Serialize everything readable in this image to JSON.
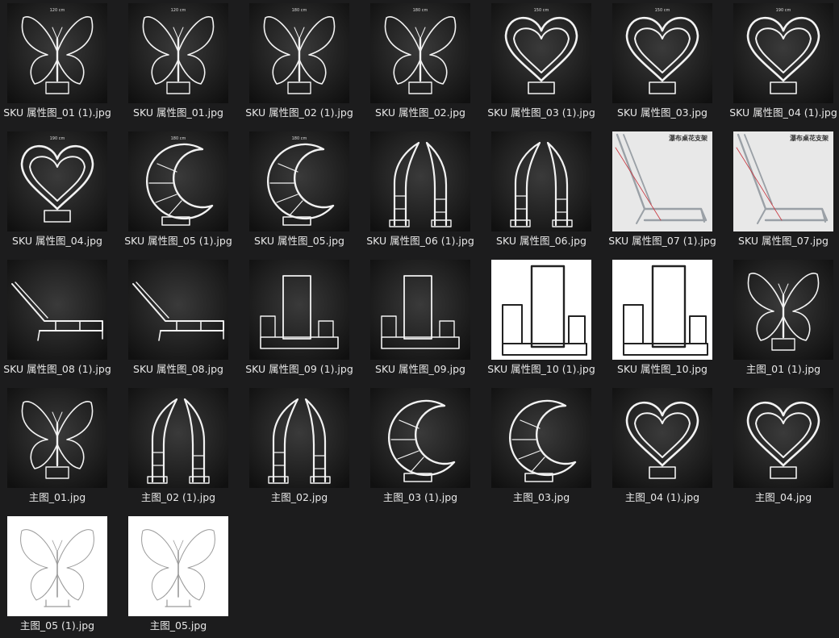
{
  "files": [
    {
      "name": "SKU 属性图_01 (1).jpg",
      "shape": "butterfly-icon",
      "bg": "dark",
      "measure": "120 cm"
    },
    {
      "name": "SKU 属性图_01.jpg",
      "shape": "butterfly-icon",
      "bg": "dark",
      "measure": "120 cm"
    },
    {
      "name": "SKU 属性图_02 (1).jpg",
      "shape": "butterfly-icon",
      "bg": "dark",
      "measure": "180 cm"
    },
    {
      "name": "SKU 属性图_02.jpg",
      "shape": "butterfly-icon",
      "bg": "dark",
      "measure": "180 cm"
    },
    {
      "name": "SKU 属性图_03 (1).jpg",
      "shape": "heart-icon",
      "bg": "dark",
      "measure": "150 cm"
    },
    {
      "name": "SKU 属性图_03.jpg",
      "shape": "heart-icon",
      "bg": "dark",
      "measure": "150 cm"
    },
    {
      "name": "SKU 属性图_04 (1).jpg",
      "shape": "heart-icon",
      "bg": "dark",
      "measure": "190 cm"
    },
    {
      "name": "SKU 属性图_04.jpg",
      "shape": "heart-icon",
      "bg": "dark",
      "measure": "190 cm"
    },
    {
      "name": "SKU 属性图_05 (1).jpg",
      "shape": "moon-icon",
      "bg": "dark",
      "measure": "180 cm"
    },
    {
      "name": "SKU 属性图_05.jpg",
      "shape": "moon-icon",
      "bg": "dark",
      "measure": "180 cm"
    },
    {
      "name": "SKU 属性图_06 (1).jpg",
      "shape": "arch-icon",
      "bg": "dark",
      "measure": ""
    },
    {
      "name": "SKU 属性图_06.jpg",
      "shape": "arch-icon",
      "bg": "dark",
      "measure": ""
    },
    {
      "name": "SKU 属性图_07 (1).jpg",
      "shape": "stand-icon",
      "bg": "grey",
      "measure": "瀑布桌花支架"
    },
    {
      "name": "SKU 属性图_07.jpg",
      "shape": "stand-icon",
      "bg": "grey",
      "measure": "瀑布桌花支架"
    },
    {
      "name": "SKU 属性图_08 (1).jpg",
      "shape": "lounger-icon",
      "bg": "dark",
      "measure": ""
    },
    {
      "name": "SKU 属性图_08.jpg",
      "shape": "lounger-icon",
      "bg": "dark",
      "measure": ""
    },
    {
      "name": "SKU 属性图_09 (1).jpg",
      "shape": "frame-rack-icon",
      "bg": "dark",
      "measure": ""
    },
    {
      "name": "SKU 属性图_09.jpg",
      "shape": "frame-rack-icon",
      "bg": "dark",
      "measure": ""
    },
    {
      "name": "SKU 属性图_10 (1).jpg",
      "shape": "frame-rack-black-icon",
      "bg": "light",
      "measure": ""
    },
    {
      "name": "SKU 属性图_10.jpg",
      "shape": "frame-rack-black-icon",
      "bg": "light",
      "measure": ""
    },
    {
      "name": "主图_01 (1).jpg",
      "shape": "butterfly-icon",
      "bg": "dark",
      "measure": ""
    },
    {
      "name": "主图_01.jpg",
      "shape": "butterfly-icon",
      "bg": "dark",
      "measure": ""
    },
    {
      "name": "主图_02 (1).jpg",
      "shape": "arch-icon",
      "bg": "dark",
      "measure": ""
    },
    {
      "name": "主图_02.jpg",
      "shape": "arch-icon",
      "bg": "dark",
      "measure": ""
    },
    {
      "name": "主图_03 (1).jpg",
      "shape": "moon-icon",
      "bg": "dark",
      "measure": ""
    },
    {
      "name": "主图_03.jpg",
      "shape": "moon-icon",
      "bg": "dark",
      "measure": ""
    },
    {
      "name": "主图_04 (1).jpg",
      "shape": "heart-icon",
      "bg": "dark",
      "measure": ""
    },
    {
      "name": "主图_04.jpg",
      "shape": "heart-icon",
      "bg": "dark",
      "measure": ""
    },
    {
      "name": "主图_05 (1).jpg",
      "shape": "butterfly-outline-icon",
      "bg": "light",
      "measure": ""
    },
    {
      "name": "主图_05.jpg",
      "shape": "butterfly-outline-icon",
      "bg": "light",
      "measure": ""
    }
  ],
  "colors": {
    "background": "#1c1c1d",
    "label": "#e8e8e8",
    "frame_white": "#f2f2f2",
    "frame_black": "#222222",
    "measure_red": "#c8323c"
  }
}
